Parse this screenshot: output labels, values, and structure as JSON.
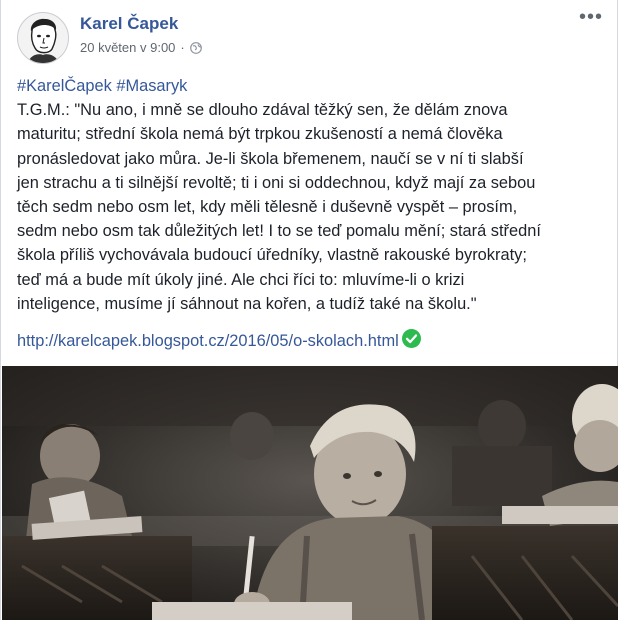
{
  "post": {
    "author": "Karel Čapek",
    "date": "20 květen v 9:00",
    "hashtags": [
      "#KarelČapek",
      "#Masaryk"
    ],
    "lines": [
      "T.G.M.: \"Nu ano, i mně se dlouho zdával těžký sen, že dělám znova",
      "maturitu; střední škola nemá být trpkou zkušeností a nemá člověka",
      "pronásledovat jako můra. Je-li škola břemenem, naučí se v ní ti slabší",
      "jen strachu a ti silnější revoltě; ti i oni si oddechnou, když mají za sebou",
      "těch sedm nebo osm let, kdy měli tělesně i duševně vyspět – prosím,",
      "sedm nebo osm tak důležitých let! I to se teď pomalu mění; stará střední",
      "škola příliš vychovávala budoucí úředníky, vlastně rakouské byrokraty;",
      "teď má a bude mít úkoly jiné. Ale chci říci to: mluvíme-li o krizi",
      "inteligence, musíme jí sáhnout na kořen, a tudíž také na školu.\""
    ],
    "link": "http://karelcapek.blogspot.cz/2016/05/o-skolach.html"
  },
  "icons": {
    "avatar": "avatar-portrait",
    "privacy": "globe-icon",
    "more": "more-options-icon",
    "verified": "check-circle-icon"
  },
  "colors": {
    "link": "#365899",
    "text": "#1d2129",
    "meta": "#616770",
    "check": "#2dba4e"
  }
}
